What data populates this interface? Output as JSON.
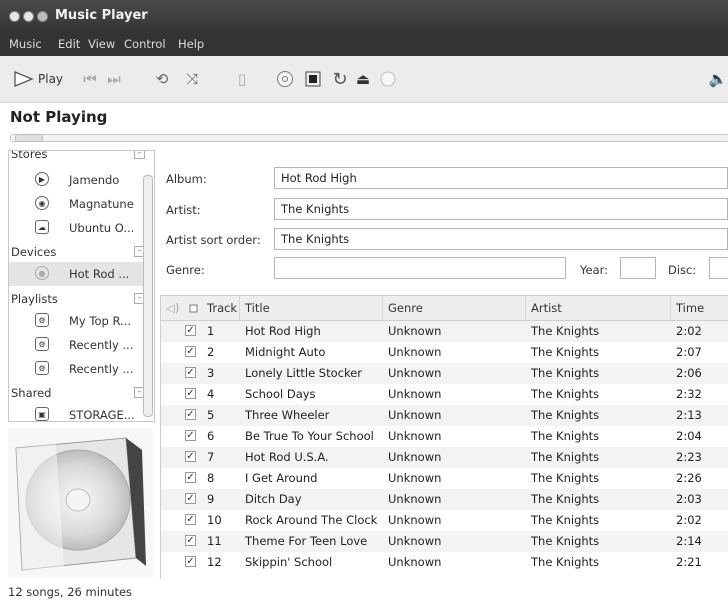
{
  "window": {
    "title": "Music Player"
  },
  "menu": [
    "Music",
    "Edit",
    "View",
    "Control",
    "Help"
  ],
  "toolbar": {
    "play_label": "Play"
  },
  "now_playing": "Not Playing",
  "sidebar": {
    "stores_label": "Stores",
    "stores": [
      {
        "label": "Jamendo",
        "icon": "jamendo-icon"
      },
      {
        "label": "Magnatune",
        "icon": "magnatune-icon"
      },
      {
        "label": "Ubuntu O...",
        "icon": "ubuntu-one-icon"
      }
    ],
    "devices_label": "Devices",
    "devices": [
      {
        "label": "Hot Rod ...",
        "icon": "cd-icon"
      }
    ],
    "playlists_label": "Playlists",
    "playlists": [
      {
        "label": "My Top R...",
        "icon": "smart-playlist-icon"
      },
      {
        "label": "Recently ...",
        "icon": "smart-playlist-icon"
      },
      {
        "label": "Recently ...",
        "icon": "smart-playlist-icon"
      }
    ],
    "shared_label": "Shared",
    "shared": [
      {
        "label": "STORAGE...",
        "icon": "network-share-icon"
      }
    ],
    "collapse_glyph": "–"
  },
  "album_form": {
    "album_label": "Album:",
    "album_value": "Hot Rod High",
    "artist_label": "Artist:",
    "artist_value": "The Knights",
    "sort_label": "Artist sort order:",
    "sort_value": "The Knights",
    "genre_label": "Genre:",
    "genre_value": "",
    "year_label": "Year:",
    "year_value": "",
    "disc_label": "Disc:",
    "disc_value": ""
  },
  "table": {
    "columns": [
      "Track",
      "Title",
      "Genre",
      "Artist",
      "Time"
    ],
    "rows": [
      {
        "track": "1",
        "title": "Hot Rod High",
        "genre": "Unknown",
        "artist": "The Knights",
        "time": "2:02",
        "checked": true
      },
      {
        "track": "2",
        "title": "Midnight Auto",
        "genre": "Unknown",
        "artist": "The Knights",
        "time": "2:07",
        "checked": true
      },
      {
        "track": "3",
        "title": "Lonely Little Stocker",
        "genre": "Unknown",
        "artist": "The Knights",
        "time": "2:06",
        "checked": true
      },
      {
        "track": "4",
        "title": "School Days",
        "genre": "Unknown",
        "artist": "The Knights",
        "time": "2:32",
        "checked": true
      },
      {
        "track": "5",
        "title": "Three Wheeler",
        "genre": "Unknown",
        "artist": "The Knights",
        "time": "2:13",
        "checked": true
      },
      {
        "track": "6",
        "title": "Be True To Your School",
        "genre": "Unknown",
        "artist": "The Knights",
        "time": "2:04",
        "checked": true
      },
      {
        "track": "7",
        "title": "Hot Rod U.S.A.",
        "genre": "Unknown",
        "artist": "The Knights",
        "time": "2:23",
        "checked": true
      },
      {
        "track": "8",
        "title": "I Get Around",
        "genre": "Unknown",
        "artist": "The Knights",
        "time": "2:26",
        "checked": true
      },
      {
        "track": "9",
        "title": "Ditch Day",
        "genre": "Unknown",
        "artist": "The Knights",
        "time": "2:03",
        "checked": true
      },
      {
        "track": "10",
        "title": "Rock Around The Clock",
        "genre": "Unknown",
        "artist": "The Knights",
        "time": "2:02",
        "checked": true
      },
      {
        "track": "11",
        "title": "Theme For Teen Love",
        "genre": "Unknown",
        "artist": "The Knights",
        "time": "2:14",
        "checked": true
      },
      {
        "track": "12",
        "title": "Skippin' School",
        "genre": "Unknown",
        "artist": "The Knights",
        "time": "2:21",
        "checked": true
      }
    ]
  },
  "status": "12 songs, 26 minutes",
  "colors": {
    "titlebar": "#3a3a3a",
    "accent": "#333333"
  }
}
